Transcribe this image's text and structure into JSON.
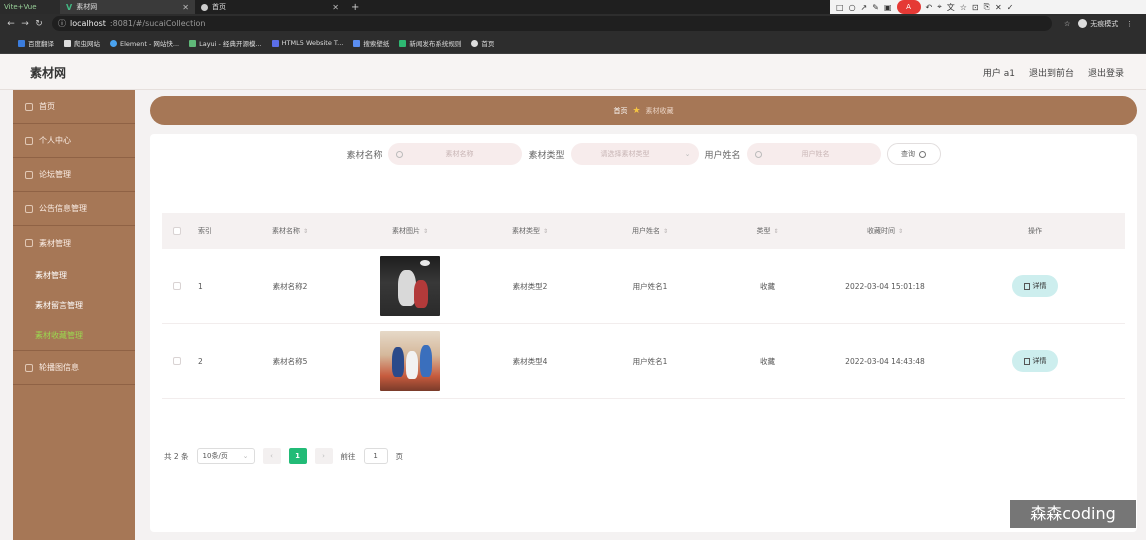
{
  "browser": {
    "dev_tab_label": "Vite+Vue",
    "tabs": [
      {
        "title": "素材网",
        "active": true
      },
      {
        "title": "首页",
        "active": false
      }
    ],
    "url_host": "localhost",
    "url_path": ":8081/#/sucaiCollection",
    "incognito_label": "无痕模式",
    "bookmarks": [
      {
        "label": "百度翻译",
        "color": "#3b7ddd"
      },
      {
        "label": "爬虫网站",
        "color": "#dddddd"
      },
      {
        "label": "Element - 网站快...",
        "color": "#4aa3f0"
      },
      {
        "label": "Layui - 经典开源模...",
        "color": "#5fb878"
      },
      {
        "label": "HTML5 Website T...",
        "color": "#5b6ee8"
      },
      {
        "label": "搜索壁纸",
        "color": "#5a8df0"
      },
      {
        "label": "新闻发布系统规则",
        "color": "#2eb872"
      },
      {
        "label": "首页",
        "color": "#dddddd"
      }
    ]
  },
  "header": {
    "title": "素材网",
    "user_label": "用户 a1",
    "back_label": "退出到前台",
    "logout_label": "退出登录"
  },
  "sidebar": {
    "items": [
      {
        "label": "首页",
        "icon": "home-icon"
      },
      {
        "label": "个人中心",
        "icon": "user-icon"
      },
      {
        "label": "论坛管理",
        "icon": "forum-icon"
      },
      {
        "label": "公告信息管理",
        "icon": "notice-icon"
      },
      {
        "label": "素材管理",
        "icon": "material-icon"
      }
    ],
    "submenu": [
      {
        "label": "素材管理",
        "active": false
      },
      {
        "label": "素材留言管理",
        "active": false
      },
      {
        "label": "素材收藏管理",
        "active": true
      }
    ],
    "last_item": {
      "label": "轮播图信息",
      "icon": "carousel-icon"
    },
    "colors": {
      "bg": "#a67756",
      "active_sub": "#9bd84f"
    }
  },
  "breadcrumb": {
    "home": "首页",
    "current": "素材收藏"
  },
  "search": {
    "name_label": "素材名称",
    "name_placeholder": "素材名称",
    "type_label": "素材类型",
    "type_placeholder": "请选择素材类型",
    "user_label": "用户姓名",
    "user_placeholder": "用户姓名",
    "query_label": "查询"
  },
  "table": {
    "headers": {
      "index": "索引",
      "name": "素材名称",
      "image": "素材图片",
      "type": "素材类型",
      "user": "用户姓名",
      "kind": "类型",
      "time": "收藏时间",
      "op": "操作"
    },
    "rows": [
      {
        "index": "1",
        "name": "素材名称2",
        "type": "素材类型2",
        "user": "用户姓名1",
        "kind": "收藏",
        "time": "2022-03-04 15:01:18",
        "detail": "详情"
      },
      {
        "index": "2",
        "name": "素材名称5",
        "type": "素材类型4",
        "user": "用户姓名1",
        "kind": "收藏",
        "time": "2022-03-04 14:43:48",
        "detail": "详情"
      }
    ]
  },
  "pager": {
    "total": "共 2 条",
    "page_size": "10条/页",
    "current_page": "1",
    "goto_prefix": "前往",
    "goto_value": "1",
    "goto_suffix": "页"
  },
  "watermark": "森森coding"
}
